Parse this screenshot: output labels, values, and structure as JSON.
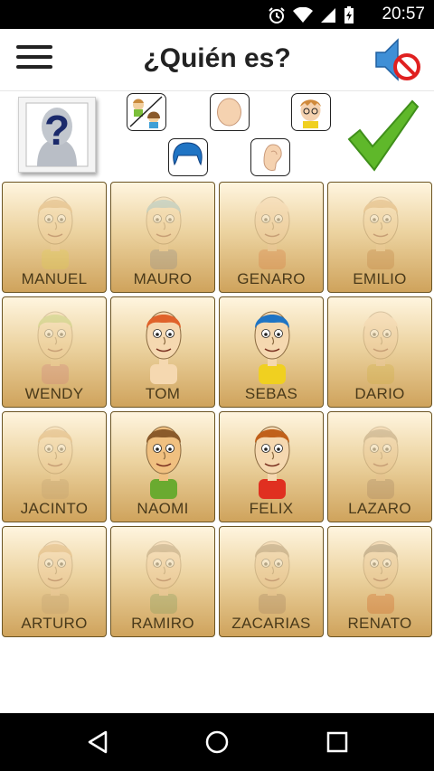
{
  "status_bar": {
    "time": "20:57",
    "icons": [
      "alarm-icon",
      "wifi-icon",
      "signal-icon",
      "battery-charging-icon"
    ]
  },
  "header": {
    "title": "¿Quién es?",
    "menu_icon": "hamburger-menu-icon",
    "sound_icon": "speaker-muted-icon"
  },
  "controls": {
    "question_card_icon": "question-mark-icon",
    "filters": [
      "gender-filter",
      "bald-filter",
      "glasses-filter",
      "hair-filter",
      "ears-filter"
    ],
    "confirm_icon": "checkmark-icon"
  },
  "characters": [
    {
      "name": "MANUEL",
      "faded": true,
      "skin": "#f2cf9e",
      "hair": "#c98a3c",
      "shirt": "#e0d050"
    },
    {
      "name": "MAURO",
      "faded": true,
      "skin": "#f2cf9e",
      "hair": "#6fa8b8",
      "shirt": "#8a8a8a"
    },
    {
      "name": "GENARO",
      "faded": true,
      "skin": "#f0c9a0",
      "hair": "#f0c9a0",
      "shirt": "#d97a40"
    },
    {
      "name": "EMILIO",
      "faded": true,
      "skin": "#f2cf9e",
      "hair": "#c98a3c",
      "shirt": "#c08040"
    },
    {
      "name": "WENDY",
      "faded": true,
      "skin": "#f2cf9e",
      "hair": "#9cb83c",
      "shirt": "#d08080"
    },
    {
      "name": "TOM",
      "faded": false,
      "skin": "#f5d8b0",
      "hair": "#e0622a",
      "shirt": "#f5d8b0"
    },
    {
      "name": "SEBAS",
      "faded": false,
      "skin": "#f5d8b0",
      "hair": "#1f74c4",
      "shirt": "#f0d020"
    },
    {
      "name": "DARIO",
      "faded": true,
      "skin": "#f0c9a0",
      "hair": "#f0c9a0",
      "shirt": "#d0b040"
    },
    {
      "name": "JACINTO",
      "faded": true,
      "skin": "#f2cf9e",
      "hair": "#c98a3c",
      "shirt": "#c0a070"
    },
    {
      "name": "NAOMI",
      "faded": false,
      "skin": "#f0c080",
      "hair": "#8a5a2a",
      "shirt": "#6aaa30"
    },
    {
      "name": "FELIX",
      "faded": false,
      "skin": "#f5d8b0",
      "hair": "#c0601a",
      "shirt": "#e03020"
    },
    {
      "name": "LAZARO",
      "faded": true,
      "skin": "#e8c090",
      "hair": "#8a6a40",
      "shirt": "#a08060"
    },
    {
      "name": "ARTURO",
      "faded": true,
      "skin": "#f0c9a0",
      "hair": "#c98a3c",
      "shirt": "#c0a070"
    },
    {
      "name": "RAMIRO",
      "faded": true,
      "skin": "#f0c9a0",
      "hair": "#8a6a40",
      "shirt": "#7a9a5a"
    },
    {
      "name": "ZACARIAS",
      "faded": true,
      "skin": "#e8c090",
      "hair": "#7a5a30",
      "shirt": "#a08060"
    },
    {
      "name": "RENATO",
      "faded": true,
      "skin": "#e8c090",
      "hair": "#6a5030",
      "shirt": "#d06020"
    }
  ],
  "nav_bar": {
    "icons": [
      "back-icon",
      "home-icon",
      "recents-icon"
    ]
  }
}
